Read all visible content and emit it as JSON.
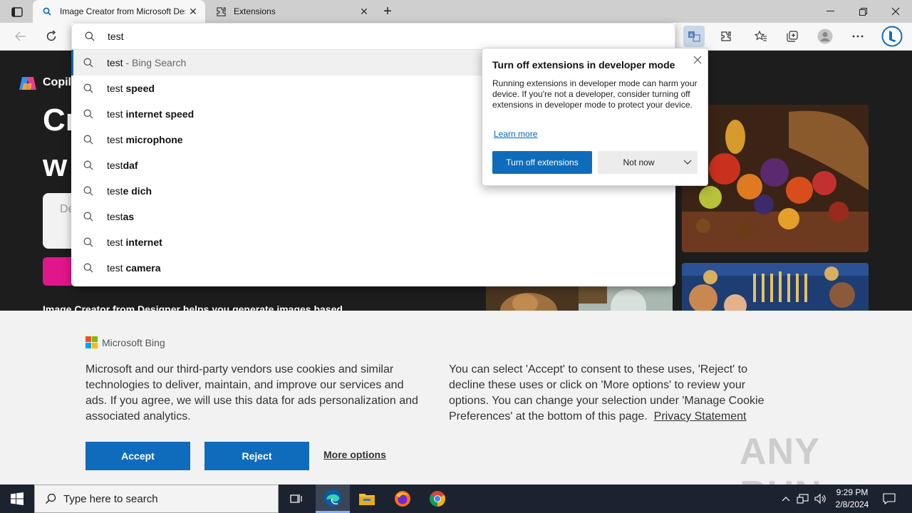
{
  "tabs": [
    {
      "title": "Image Creator from Microsoft Designer",
      "active": true,
      "icon": "search-icon"
    },
    {
      "title": "Extensions",
      "active": false,
      "icon": "puzzle-icon"
    }
  ],
  "omnibox": {
    "value": "test",
    "suggestions": [
      {
        "prefix": "test",
        "rest": "",
        "suffix": " - Bing Search",
        "selected": true
      },
      {
        "prefix": "test ",
        "rest": "speed",
        "suffix": ""
      },
      {
        "prefix": "test ",
        "rest": "internet speed",
        "suffix": ""
      },
      {
        "prefix": "test ",
        "rest": "microphone",
        "suffix": ""
      },
      {
        "prefix": "test",
        "rest": "daf",
        "suffix": ""
      },
      {
        "prefix": "test",
        "rest": "e dich",
        "suffix": ""
      },
      {
        "prefix": "test",
        "rest": "as",
        "suffix": ""
      },
      {
        "prefix": "test ",
        "rest": "internet",
        "suffix": ""
      },
      {
        "prefix": "test ",
        "rest": "camera",
        "suffix": ""
      }
    ]
  },
  "page": {
    "brand": "Copil",
    "hero_line1": "Cr",
    "hero_line2": "w",
    "prompt_placeholder": "De",
    "description": "Image Creator from Designer helps you generate images based"
  },
  "ext_popup": {
    "title": "Turn off extensions in developer mode",
    "body": "Running extensions in developer mode can harm your device. If you're not a developer, consider turning off extensions in developer mode to protect your device.",
    "learn_more": "Learn more",
    "primary": "Turn off extensions",
    "secondary": "Not now"
  },
  "cookie": {
    "brand": "Microsoft Bing",
    "left_text": "Microsoft and our third-party vendors use cookies and similar technologies to deliver, maintain, and improve our services and ads. If you agree, we will use this data for ads personalization and associated analytics.",
    "right_text": "You can select 'Accept' to consent to these uses, 'Reject' to decline these uses or click on 'More options' to review your options. You can change your selection under 'Manage Cookie Preferences' at the bottom of this page.",
    "privacy_link": "Privacy Statement",
    "accept": "Accept",
    "reject": "Reject",
    "more_options": "More options"
  },
  "watermark": "ANY RUN",
  "taskbar": {
    "search_placeholder": "Type here to search",
    "time": "9:29 PM",
    "date": "2/8/2024"
  },
  "colors": {
    "accent": "#0f6cbd",
    "pink": "#e3158a"
  }
}
